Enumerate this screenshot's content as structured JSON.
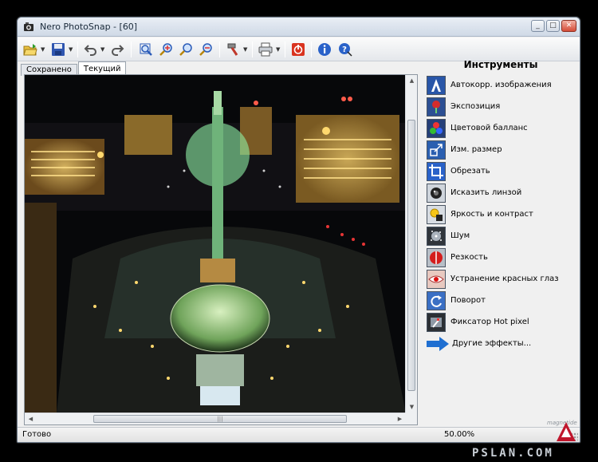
{
  "window": {
    "title": "Nero PhotoSnap - [60]",
    "minimize_glyph": "_",
    "maximize_glyph": "□",
    "close_glyph": "✕"
  },
  "toolbar": {
    "icons": [
      "open-folder-icon",
      "save-icon",
      "undo-icon",
      "redo-icon",
      "zoom-fit-icon",
      "zoom-in-icon",
      "zoom-out-icon",
      "zoom-actual-icon",
      "tools-hammer-icon",
      "print-icon",
      "exit-icon",
      "info-icon",
      "help-icon"
    ]
  },
  "tabs": [
    {
      "label": "Сохранено",
      "active": false
    },
    {
      "label": "Текущий",
      "active": true
    }
  ],
  "panel": {
    "title": "Инструменты",
    "tools": [
      {
        "label": "Автокорр. изображения",
        "icon": "auto-correct-icon"
      },
      {
        "label": "Экспозиция",
        "icon": "exposure-icon"
      },
      {
        "label": "Цветовой балланс",
        "icon": "color-balance-icon"
      },
      {
        "label": "Изм. размер",
        "icon": "resize-icon"
      },
      {
        "label": "Обрезать",
        "icon": "crop-icon"
      },
      {
        "label": "Исказить линзой",
        "icon": "lens-distort-icon"
      },
      {
        "label": "Яркость и контраст",
        "icon": "brightness-contrast-icon"
      },
      {
        "label": "Шум",
        "icon": "noise-icon"
      },
      {
        "label": "Резкость",
        "icon": "sharpen-icon"
      },
      {
        "label": "Устранение красных глаз",
        "icon": "red-eye-icon"
      },
      {
        "label": "Поворот",
        "icon": "rotate-icon"
      },
      {
        "label": "Фиксатор Hot pixel",
        "icon": "hot-pixel-icon"
      },
      {
        "label": "Другие эффекты...",
        "icon": "more-effects-arrow-icon"
      }
    ]
  },
  "status": {
    "text": "Готово",
    "zoom": "50.00%"
  },
  "watermark": {
    "site": "PSLAN.COM",
    "small": "magnetide"
  },
  "colors": {
    "accent": "#1f6fd1",
    "close_red": "#d44b37"
  }
}
